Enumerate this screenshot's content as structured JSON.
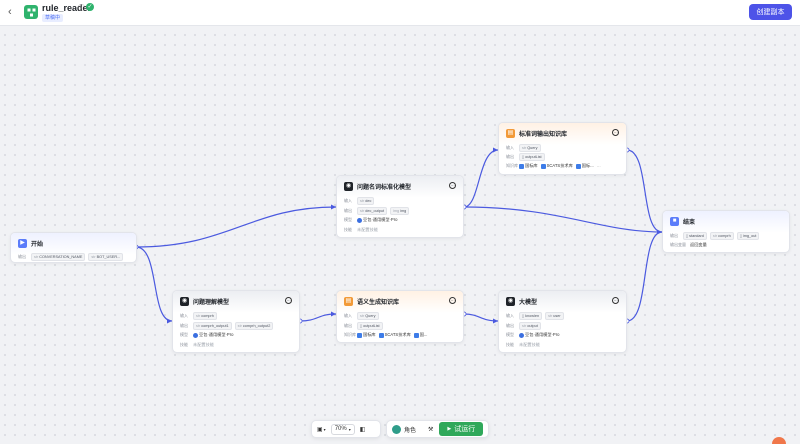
{
  "header": {
    "back_icon": "chevron-left-icon",
    "app_name": "rule_reader",
    "status_tag": "草稿中",
    "create_copy_label": "创建副本",
    "accent": "#4d53e8"
  },
  "nodes": {
    "start": {
      "title": "开始",
      "output_label": "输出",
      "outputs": [
        "CONVERSATION_NAME",
        "BOT_USER..."
      ]
    },
    "standard_kb": {
      "title": "标准词输出知识库",
      "input_label": "输入",
      "inputs": [
        "Query"
      ],
      "output_label": "输出",
      "outputs": [
        "outputList"
      ],
      "kb_label": "知识库",
      "kbs": [
        "国标库",
        "SCATS技术库",
        "国标..."
      ]
    },
    "term_model": {
      "title": "问题名词标准化模型",
      "input_label": "输入",
      "inputs": [
        "dec"
      ],
      "output_label": "输出",
      "outputs": [
        "dec_output",
        "img"
      ],
      "model_label": "模型",
      "model": "豆包·通用模型·Pro",
      "skill_label": "技能",
      "skill": "未配置技能"
    },
    "end": {
      "title": "结束",
      "output_label": "输出",
      "outputs": [
        "standard",
        "comprh",
        "img_out"
      ],
      "reply_label": "输出变量",
      "reply": "返回变量"
    },
    "understand_model": {
      "title": "问题理解模型",
      "input_label": "输入",
      "inputs": [
        "comprh"
      ],
      "output_label": "输出",
      "outputs": [
        "comprh_output1",
        "comprh_output2"
      ],
      "model_label": "模型",
      "model": "豆包·通用模型·Pro",
      "skill_label": "技能",
      "skill": "未配置技能"
    },
    "semantic_kb": {
      "title": "语义生成知识库",
      "input_label": "输入",
      "inputs": [
        "Query"
      ],
      "output_label": "输出",
      "outputs": [
        "outputList"
      ],
      "kb_label": "知识库",
      "kbs": [
        "国标库",
        "SCATS技术库",
        "国..."
      ]
    },
    "llm": {
      "title": "大模型",
      "input_label": "输入",
      "inputs": [
        "knowlen",
        "user"
      ],
      "output_label": "输出",
      "outputs": [
        "output"
      ],
      "model_label": "模型",
      "model": "豆包·通用模型·Pro",
      "skill_label": "技能",
      "skill": "未配置技能"
    }
  },
  "toolbar": {
    "zoom": "70%",
    "role_label": "角色",
    "run_label": "试运行",
    "run_color": "#2fa85a"
  },
  "colors": {
    "edge": "#4b5ae0",
    "llm_icon": "#1f2329",
    "kb_icon": "#f29a38",
    "start_icon": "#5b7cfa"
  }
}
